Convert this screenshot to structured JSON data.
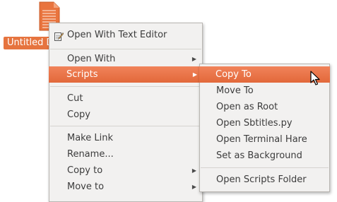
{
  "desktop_file": {
    "label": "Untitled Document"
  },
  "context_menu": {
    "items": [
      {
        "label": "Open With Text Editor",
        "icon": "text-editor-icon"
      },
      {
        "label": "Open With",
        "arrow": "▶"
      },
      {
        "label": "Scripts",
        "arrow": "▶",
        "highlighted": true
      },
      {
        "label": "Cut"
      },
      {
        "label": "Copy"
      },
      {
        "label": "Make Link"
      },
      {
        "label": "Rename..."
      },
      {
        "label": "Copy to",
        "arrow": "▶"
      },
      {
        "label": "Move to",
        "arrow": "▶"
      }
    ]
  },
  "scripts_submenu": {
    "items": [
      {
        "label": "Copy To",
        "highlighted": true
      },
      {
        "label": "Move To"
      },
      {
        "label": "Open as Root"
      },
      {
        "label": "Open Sbtitles.py"
      },
      {
        "label": "Open Terminal Hare"
      },
      {
        "label": "Set as Background"
      },
      {
        "label": "Open Scripts Folder"
      }
    ]
  },
  "colors": {
    "highlight": "#e6743f",
    "menu_background": "#f2f1f0",
    "text": "#3c3c3c"
  }
}
